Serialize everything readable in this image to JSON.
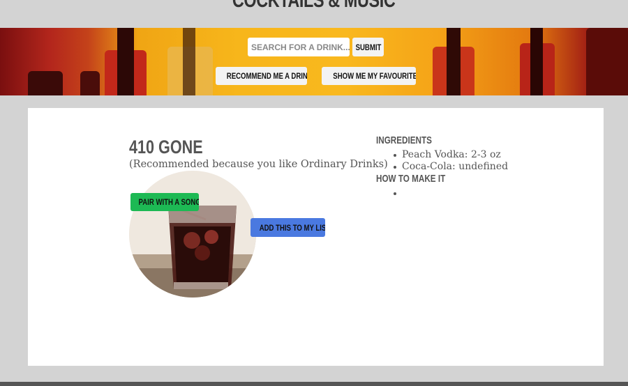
{
  "header": {
    "site_title": "COCKTAILS & MUSIC"
  },
  "search": {
    "placeholder": "SEARCH FOR A DRINK...",
    "submit_label": "SUBMIT"
  },
  "actions": {
    "recommend_label": "RECOMMEND ME A DRINK!",
    "favourites_label": "SHOW ME MY FAVOURITES!"
  },
  "drink": {
    "name": "410 GONE",
    "reason": "(Recommended because you like Ordinary Drinks)",
    "image_icon": "cocktail-glass-photo",
    "pair_label": "PAIR WITH A SONG!",
    "add_label": "ADD THIS TO MY LIST",
    "ingredients_heading": "INGREDIENTS",
    "ingredients": [
      "Peach Vodka: 2-3 oz",
      "Coca-Cola: undefined"
    ],
    "howto_heading": "HOW TO MAKE IT",
    "steps": [
      ""
    ]
  },
  "colors": {
    "page_bg": "#d3d3d3",
    "pair_button": "#1db954",
    "add_button": "#4a79e0",
    "footer": "#555555"
  }
}
